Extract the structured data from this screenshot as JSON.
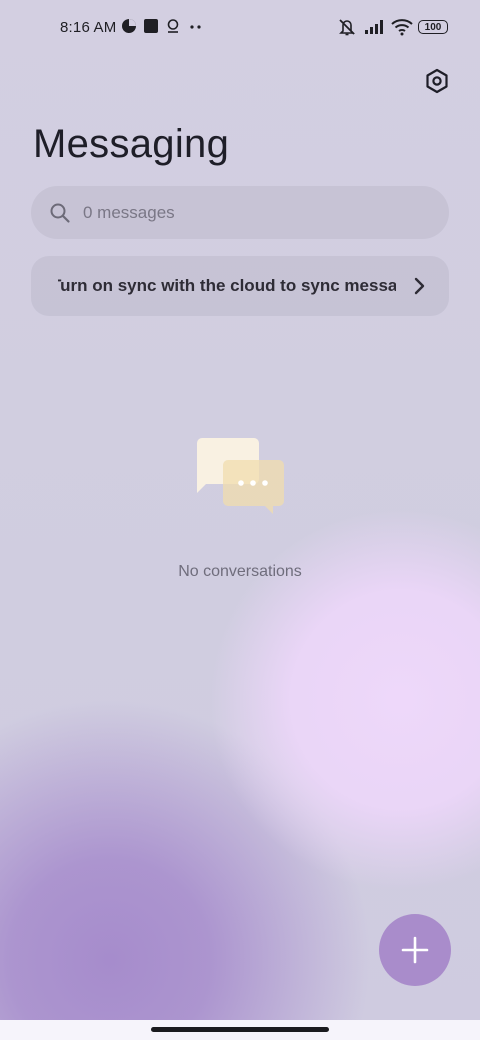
{
  "status_bar": {
    "time": "8:16 AM",
    "battery": "100",
    "icons": [
      "data-saver-icon",
      "square-app-icon",
      "assistant-icon",
      "more-dots-icon",
      "mute-vibrate-icon",
      "signal-icon",
      "wifi-icon",
      "battery-icon"
    ]
  },
  "header": {
    "title": "Messaging",
    "settings_icon": "settings-hex-icon"
  },
  "search": {
    "placeholder": "0 messages"
  },
  "sync_banner": {
    "text": "Turn on sync with the cloud to sync messages"
  },
  "empty_state": {
    "text": "No conversations",
    "illustration": "chat-bubbles-icon"
  },
  "fab": {
    "icon": "plus-icon"
  },
  "colors": {
    "accent": "#a98ccb",
    "title": "#1e1e28",
    "muted": "#6f6d7c"
  }
}
